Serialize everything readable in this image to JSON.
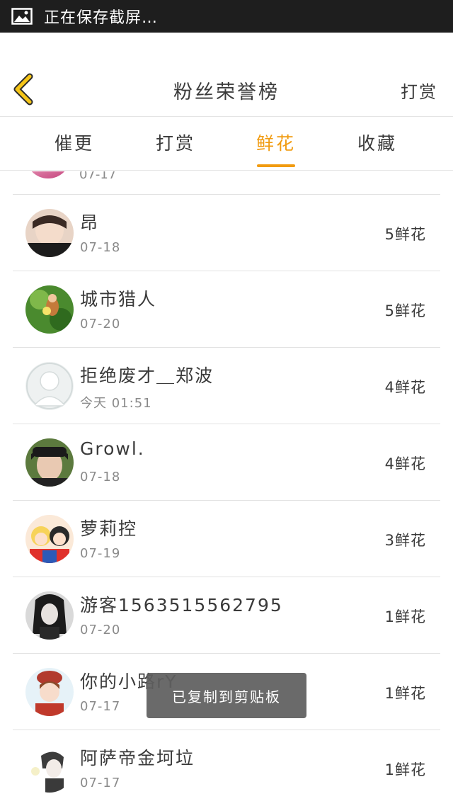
{
  "status_bar": {
    "icon": "image-icon",
    "text": "正在保存截屏…"
  },
  "header": {
    "back_icon": "chevron-left-icon",
    "title": "粉丝荣誉榜",
    "action_label": "打赏",
    "accent_color": "#f5c518"
  },
  "tabs": [
    {
      "label": "催更",
      "active": false
    },
    {
      "label": "打赏",
      "active": false
    },
    {
      "label": "鲜花",
      "active": true
    },
    {
      "label": "收藏",
      "active": false
    }
  ],
  "colors": {
    "active_tab": "#f19b10",
    "status_bar_bg": "#1e1e1e",
    "divider": "#e2e2e2"
  },
  "list": {
    "partial_row": {
      "date": "07-17"
    },
    "rows": [
      {
        "name": "昂",
        "date": "07-18",
        "flowers": "5鲜花"
      },
      {
        "name": "城市猎人",
        "date": "07-20",
        "flowers": "5鲜花"
      },
      {
        "name": "拒绝废才＿郑波",
        "date": "今天 01:51",
        "flowers": "4鲜花"
      },
      {
        "name": "Growl.",
        "date": "07-18",
        "flowers": "4鲜花"
      },
      {
        "name": "萝莉控",
        "date": "07-19",
        "flowers": "3鲜花"
      },
      {
        "name": "游客1563515562795",
        "date": "07-20",
        "flowers": "1鲜花"
      },
      {
        "name": "你的小路rY",
        "date": "07-17",
        "flowers": "1鲜花"
      },
      {
        "name": "阿萨帝金坷垃",
        "date": "07-17",
        "flowers": "1鲜花"
      }
    ]
  },
  "toast": {
    "text": "已复制到剪贴板"
  }
}
